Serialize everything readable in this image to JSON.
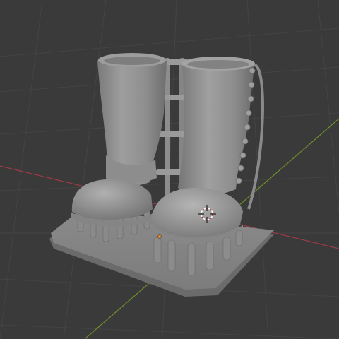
{
  "viewport": {
    "kind": "3d-viewport",
    "background_color": "#3a3a3a",
    "grid_color": "#444444",
    "x_axis_color": "#9c3b47",
    "y_axis_color": "#6e8f2a"
  },
  "scene": {
    "objects": [
      {
        "name": "boots-mesh",
        "color": "#8f8f8f"
      }
    ],
    "cursor_icon": "3d-cursor-icon",
    "origin_icon": "object-origin-icon",
    "origin_color": "#e88b2f"
  }
}
